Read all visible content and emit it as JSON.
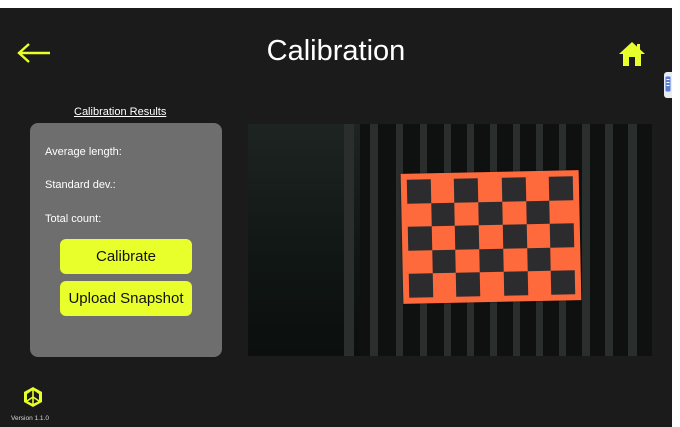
{
  "header": {
    "title": "Calibration",
    "back_icon": "arrow-left-icon",
    "home_icon": "home-icon",
    "accent_color": "#e8ff2b"
  },
  "side_tab": {
    "icon": "document-icon"
  },
  "results": {
    "heading": "Calibration Results",
    "average_length_label": "Average length:",
    "standard_dev_label": "Standard dev.:",
    "total_count_label": "Total count:"
  },
  "actions": {
    "calibrate_label": "Calibrate",
    "upload_label": "Upload Snapshot"
  },
  "camera": {
    "content": "camera-feed-with-checkerboard",
    "board_color": "#ff6a3d"
  },
  "footer": {
    "logo_icon": "app-logo-icon",
    "version": "Version 1.1.0"
  }
}
